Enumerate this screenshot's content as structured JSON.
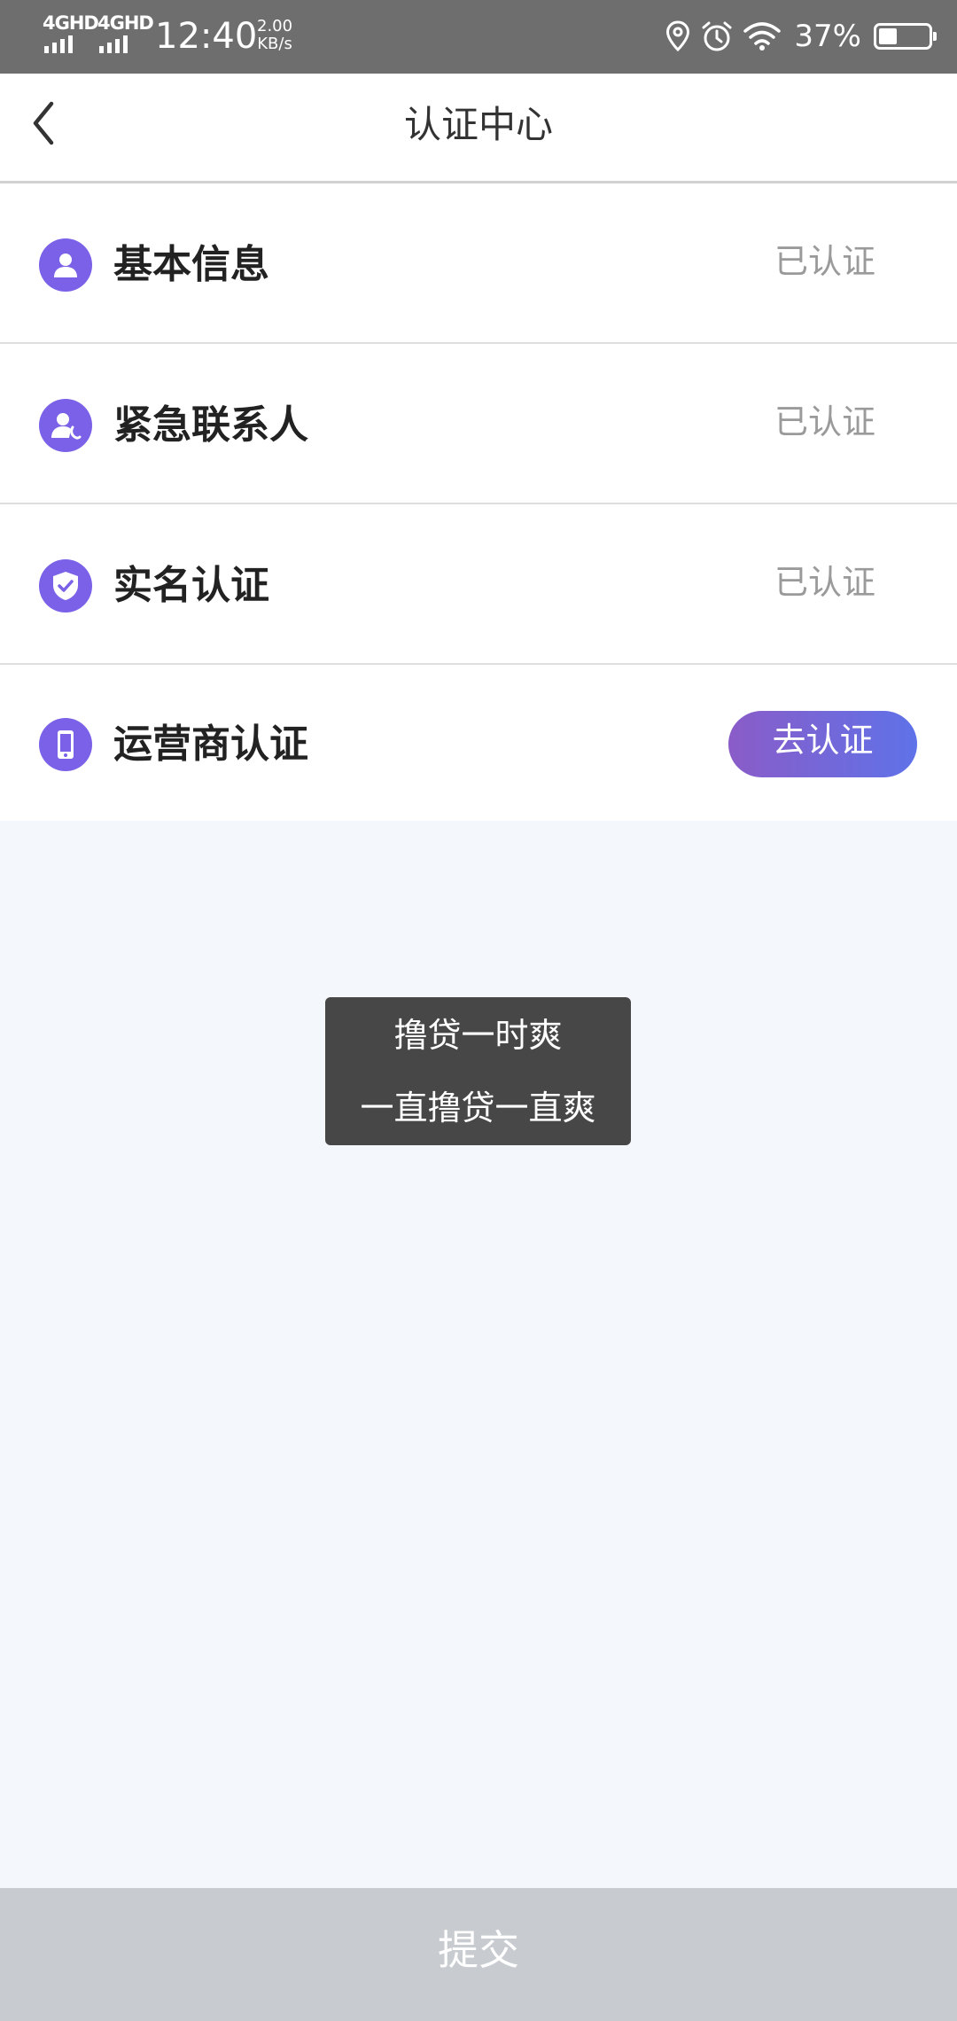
{
  "status_bar": {
    "network_1": "4GHD",
    "network_2": "4GHD",
    "time": "12:40",
    "speed_value": "2.00",
    "speed_unit": "KB/s",
    "battery_percent": "37%",
    "battery_level": 0.37,
    "icons": [
      "location-icon",
      "alarm-icon",
      "wifi-icon",
      "battery-icon"
    ]
  },
  "header": {
    "title": "认证中心",
    "back_icon": "chevron-left-icon"
  },
  "cert_items": [
    {
      "label": "基本信息",
      "icon": "user-icon",
      "status": "已认证"
    },
    {
      "label": "紧急联系人",
      "icon": "contact-phone-icon",
      "status": "已认证"
    },
    {
      "label": "实名认证",
      "icon": "shield-check-icon",
      "status": "已认证"
    },
    {
      "label": "运营商认证",
      "icon": "mobile-phone-icon",
      "action": "去认证"
    }
  ],
  "toast": {
    "line1": "撸贷一时爽",
    "line2": "一直撸贷一直爽"
  },
  "submit": {
    "label": "提交"
  },
  "colors": {
    "accent": "#7b61e8",
    "button_gradient_start": "#8a5cc8",
    "button_gradient_end": "#5f72e8",
    "submit_disabled": "#c8cbcf",
    "status_bar": "#6e6e6e"
  }
}
